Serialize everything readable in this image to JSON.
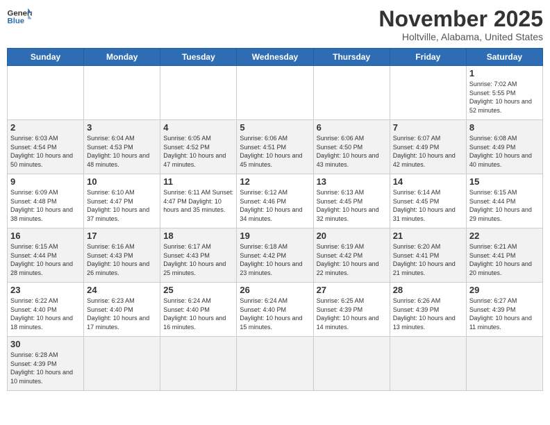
{
  "header": {
    "logo_general": "General",
    "logo_blue": "Blue",
    "month_title": "November 2025",
    "location": "Holtville, Alabama, United States"
  },
  "days_of_week": [
    "Sunday",
    "Monday",
    "Tuesday",
    "Wednesday",
    "Thursday",
    "Friday",
    "Saturday"
  ],
  "weeks": [
    [
      {
        "day": "",
        "info": ""
      },
      {
        "day": "",
        "info": ""
      },
      {
        "day": "",
        "info": ""
      },
      {
        "day": "",
        "info": ""
      },
      {
        "day": "",
        "info": ""
      },
      {
        "day": "",
        "info": ""
      },
      {
        "day": "1",
        "info": "Sunrise: 7:02 AM\nSunset: 5:55 PM\nDaylight: 10 hours and 52 minutes."
      }
    ],
    [
      {
        "day": "2",
        "info": "Sunrise: 6:03 AM\nSunset: 4:54 PM\nDaylight: 10 hours and 50 minutes."
      },
      {
        "day": "3",
        "info": "Sunrise: 6:04 AM\nSunset: 4:53 PM\nDaylight: 10 hours and 48 minutes."
      },
      {
        "day": "4",
        "info": "Sunrise: 6:05 AM\nSunset: 4:52 PM\nDaylight: 10 hours and 47 minutes."
      },
      {
        "day": "5",
        "info": "Sunrise: 6:06 AM\nSunset: 4:51 PM\nDaylight: 10 hours and 45 minutes."
      },
      {
        "day": "6",
        "info": "Sunrise: 6:06 AM\nSunset: 4:50 PM\nDaylight: 10 hours and 43 minutes."
      },
      {
        "day": "7",
        "info": "Sunrise: 6:07 AM\nSunset: 4:49 PM\nDaylight: 10 hours and 42 minutes."
      },
      {
        "day": "8",
        "info": "Sunrise: 6:08 AM\nSunset: 4:49 PM\nDaylight: 10 hours and 40 minutes."
      }
    ],
    [
      {
        "day": "9",
        "info": "Sunrise: 6:09 AM\nSunset: 4:48 PM\nDaylight: 10 hours and 38 minutes."
      },
      {
        "day": "10",
        "info": "Sunrise: 6:10 AM\nSunset: 4:47 PM\nDaylight: 10 hours and 37 minutes."
      },
      {
        "day": "11",
        "info": "Sunrise: 6:11 AM\nSunset: 4:47 PM\nDaylight: 10 hours and 35 minutes."
      },
      {
        "day": "12",
        "info": "Sunrise: 6:12 AM\nSunset: 4:46 PM\nDaylight: 10 hours and 34 minutes."
      },
      {
        "day": "13",
        "info": "Sunrise: 6:13 AM\nSunset: 4:45 PM\nDaylight: 10 hours and 32 minutes."
      },
      {
        "day": "14",
        "info": "Sunrise: 6:14 AM\nSunset: 4:45 PM\nDaylight: 10 hours and 31 minutes."
      },
      {
        "day": "15",
        "info": "Sunrise: 6:15 AM\nSunset: 4:44 PM\nDaylight: 10 hours and 29 minutes."
      }
    ],
    [
      {
        "day": "16",
        "info": "Sunrise: 6:15 AM\nSunset: 4:44 PM\nDaylight: 10 hours and 28 minutes."
      },
      {
        "day": "17",
        "info": "Sunrise: 6:16 AM\nSunset: 4:43 PM\nDaylight: 10 hours and 26 minutes."
      },
      {
        "day": "18",
        "info": "Sunrise: 6:17 AM\nSunset: 4:43 PM\nDaylight: 10 hours and 25 minutes."
      },
      {
        "day": "19",
        "info": "Sunrise: 6:18 AM\nSunset: 4:42 PM\nDaylight: 10 hours and 23 minutes."
      },
      {
        "day": "20",
        "info": "Sunrise: 6:19 AM\nSunset: 4:42 PM\nDaylight: 10 hours and 22 minutes."
      },
      {
        "day": "21",
        "info": "Sunrise: 6:20 AM\nSunset: 4:41 PM\nDaylight: 10 hours and 21 minutes."
      },
      {
        "day": "22",
        "info": "Sunrise: 6:21 AM\nSunset: 4:41 PM\nDaylight: 10 hours and 20 minutes."
      }
    ],
    [
      {
        "day": "23",
        "info": "Sunrise: 6:22 AM\nSunset: 4:40 PM\nDaylight: 10 hours and 18 minutes."
      },
      {
        "day": "24",
        "info": "Sunrise: 6:23 AM\nSunset: 4:40 PM\nDaylight: 10 hours and 17 minutes."
      },
      {
        "day": "25",
        "info": "Sunrise: 6:24 AM\nSunset: 4:40 PM\nDaylight: 10 hours and 16 minutes."
      },
      {
        "day": "26",
        "info": "Sunrise: 6:24 AM\nSunset: 4:40 PM\nDaylight: 10 hours and 15 minutes."
      },
      {
        "day": "27",
        "info": "Sunrise: 6:25 AM\nSunset: 4:39 PM\nDaylight: 10 hours and 14 minutes."
      },
      {
        "day": "28",
        "info": "Sunrise: 6:26 AM\nSunset: 4:39 PM\nDaylight: 10 hours and 13 minutes."
      },
      {
        "day": "29",
        "info": "Sunrise: 6:27 AM\nSunset: 4:39 PM\nDaylight: 10 hours and 11 minutes."
      }
    ],
    [
      {
        "day": "30",
        "info": "Sunrise: 6:28 AM\nSunset: 4:39 PM\nDaylight: 10 hours and 10 minutes."
      },
      {
        "day": "",
        "info": ""
      },
      {
        "day": "",
        "info": ""
      },
      {
        "day": "",
        "info": ""
      },
      {
        "day": "",
        "info": ""
      },
      {
        "day": "",
        "info": ""
      },
      {
        "day": "",
        "info": ""
      }
    ]
  ]
}
